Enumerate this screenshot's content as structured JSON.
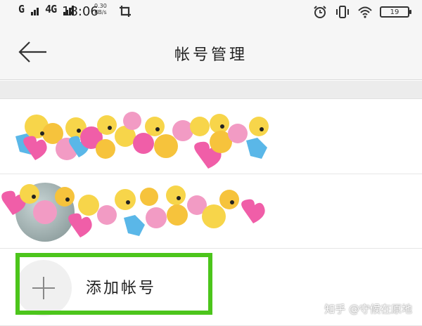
{
  "status_bar": {
    "network_1": "G",
    "network_2": "4G",
    "time": "18:06",
    "speed_value": "0.30",
    "speed_unit": "KB/s",
    "battery_level": "19"
  },
  "header": {
    "title": "帐号管理"
  },
  "accounts": [
    {
      "avatar": "sticker-collage"
    },
    {
      "avatar": "photo-with-sticker-overlay"
    }
  ],
  "add_account": {
    "label": "添加帐号"
  },
  "watermark": "知乎 @守候在原地",
  "colors": {
    "highlight_border": "#4cc51b",
    "header_bg": "#f6f6f6"
  },
  "icons": [
    "back-arrow-icon",
    "alarm-icon",
    "vibrate-icon",
    "wifi-icon",
    "battery-icon",
    "screenshot-icon",
    "plus-icon"
  ]
}
